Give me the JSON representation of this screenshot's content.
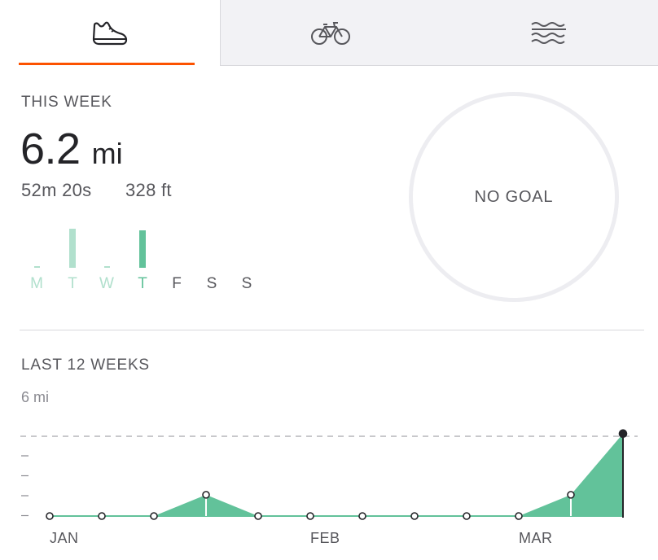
{
  "tabs": [
    {
      "name": "run",
      "icon": "shoe-icon",
      "active": true
    },
    {
      "name": "ride",
      "icon": "bike-icon",
      "active": false
    },
    {
      "name": "swim",
      "icon": "waves-icon",
      "active": false
    }
  ],
  "colors": {
    "accent": "#fc5200",
    "green": "#62c29a",
    "green_light": "#b1e0cd",
    "text_dark": "#242428",
    "text_mid": "#57575c",
    "text_light": "#8a8a91"
  },
  "this_week": {
    "label": "THIS WEEK",
    "distance": "6.2",
    "distance_unit": "mi",
    "time": "52m 20s",
    "elevation": "328 ft",
    "goal": "NO GOAL",
    "days": [
      {
        "letter": "M",
        "fraction": 0.0,
        "state": "past"
      },
      {
        "letter": "T",
        "fraction": 1.0,
        "state": "past"
      },
      {
        "letter": "W",
        "fraction": 0.0,
        "state": "past"
      },
      {
        "letter": "T",
        "fraction": 0.95,
        "state": "today"
      },
      {
        "letter": "F",
        "fraction": null,
        "state": "future"
      },
      {
        "letter": "S",
        "fraction": null,
        "state": "future"
      },
      {
        "letter": "S",
        "fraction": null,
        "state": "future"
      }
    ]
  },
  "last_12_weeks": {
    "label": "LAST 12 WEEKS",
    "axis_max_label": "6 mi"
  },
  "chart_data": {
    "type": "area",
    "title": "LAST 12 WEEKS",
    "ylim": [
      0,
      6
    ],
    "y_max_label": "6 mi",
    "x_labels": [
      {
        "week": 1,
        "text": "JAN"
      },
      {
        "week": 6,
        "text": "FEB"
      },
      {
        "week": 10,
        "text": "MAR"
      }
    ],
    "x": [
      1,
      2,
      3,
      4,
      5,
      6,
      7,
      8,
      9,
      10,
      11,
      12
    ],
    "values": [
      0,
      0,
      0,
      1.6,
      0,
      0,
      0,
      0,
      0,
      0,
      1.6,
      6.2
    ],
    "current_week": 12
  }
}
